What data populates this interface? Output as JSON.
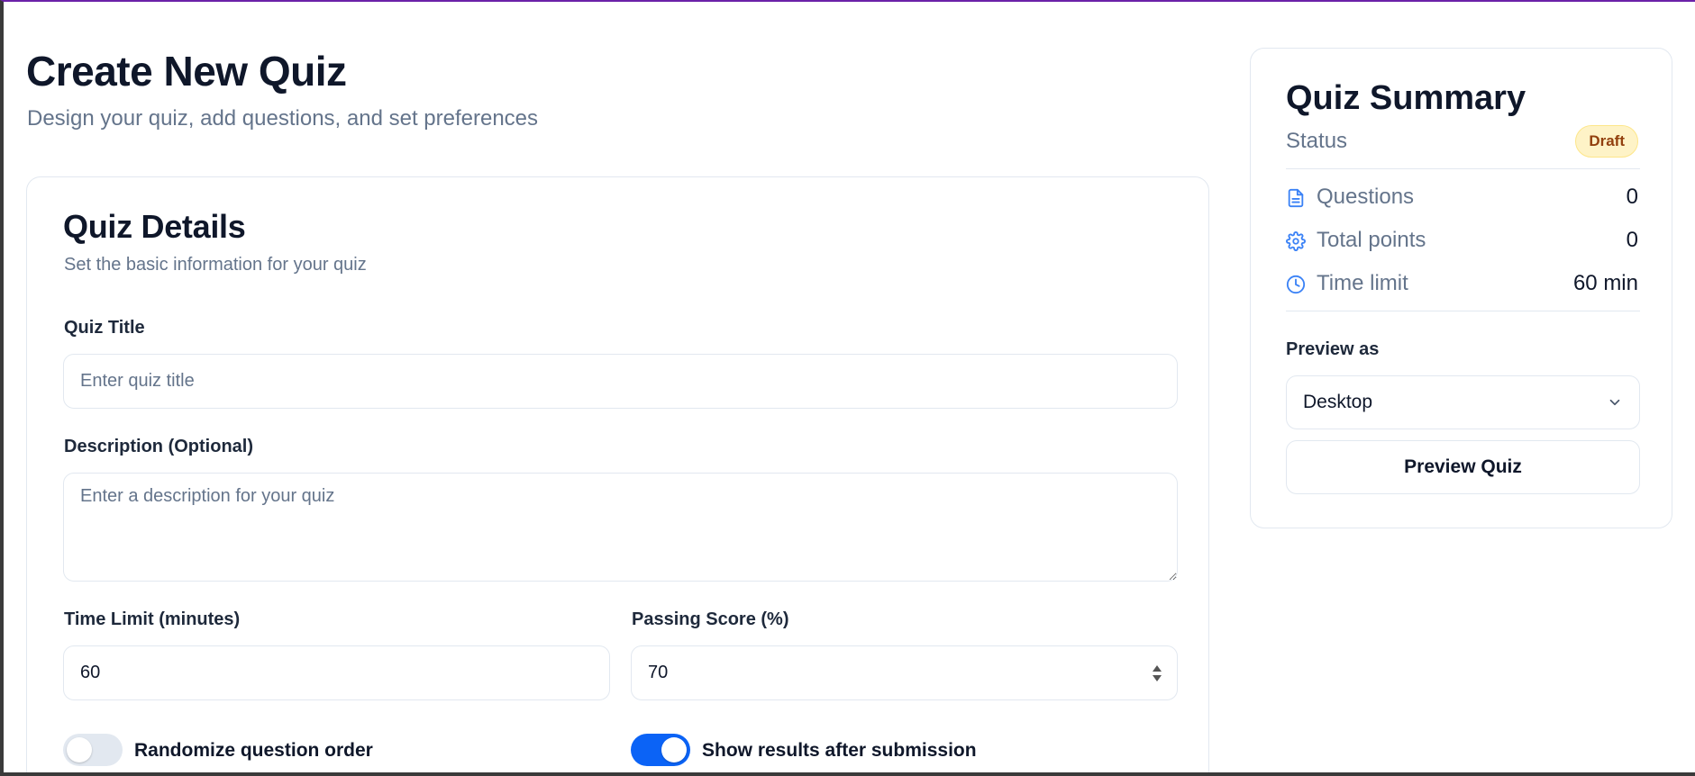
{
  "header": {
    "title": "Create New Quiz",
    "subtitle": "Design your quiz, add questions, and set preferences"
  },
  "details": {
    "title": "Quiz Details",
    "subtitle": "Set the basic information for your quiz",
    "quiz_title_label": "Quiz Title",
    "quiz_title_placeholder": "Enter quiz title",
    "quiz_title_value": "",
    "description_label": "Description (Optional)",
    "description_placeholder": "Enter a description for your quiz",
    "description_value": "",
    "time_limit_label": "Time Limit (minutes)",
    "time_limit_value": "60",
    "passing_score_label": "Passing Score (%)",
    "passing_score_value": "70",
    "randomize_label": "Randomize question order",
    "randomize_on": false,
    "show_results_label": "Show results after submission",
    "show_results_on": true
  },
  "summary": {
    "title": "Quiz Summary",
    "status_label": "Status",
    "status_badge": "Draft",
    "rows": [
      {
        "icon": "document-icon",
        "label": "Questions",
        "value": "0"
      },
      {
        "icon": "gear-icon",
        "label": "Total points",
        "value": "0"
      },
      {
        "icon": "clock-icon",
        "label": "Time limit",
        "value": "60 min"
      }
    ],
    "preview_as_label": "Preview as",
    "preview_as_value": "Desktop",
    "preview_button": "Preview Quiz"
  },
  "colors": {
    "accent": "#0b63f6",
    "top_border": "#6b21a8",
    "badge_bg": "#fef3c7",
    "badge_text": "#92400e",
    "icon": "#3b82f6"
  }
}
